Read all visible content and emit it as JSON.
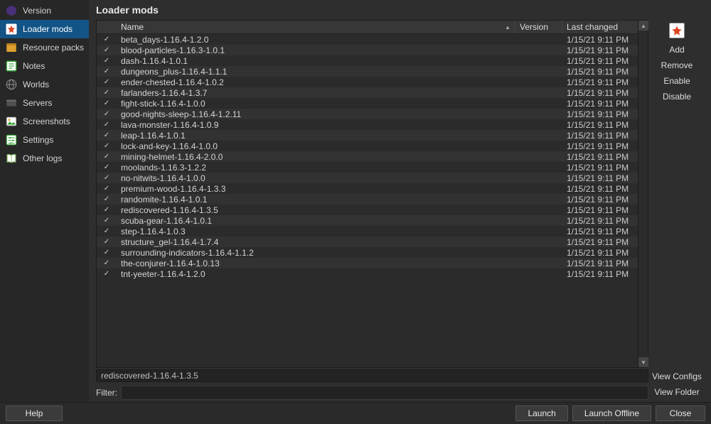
{
  "sidebar": {
    "items": [
      {
        "label": "Version",
        "icon": "cube",
        "color": "#6a3fa0"
      },
      {
        "label": "Loader mods",
        "icon": "star",
        "color": "#fff",
        "selected": true
      },
      {
        "label": "Resource packs",
        "icon": "box",
        "color": "#e0a030"
      },
      {
        "label": "Notes",
        "icon": "note",
        "color": "#3ba63b"
      },
      {
        "label": "Worlds",
        "icon": "globe",
        "color": "#777"
      },
      {
        "label": "Servers",
        "icon": "server",
        "color": "#555"
      },
      {
        "label": "Screenshots",
        "icon": "image",
        "color": "#c83"
      },
      {
        "label": "Settings",
        "icon": "sliders",
        "color": "#3ba63b"
      },
      {
        "label": "Other logs",
        "icon": "book",
        "color": "#7a5"
      }
    ]
  },
  "header": {
    "title": "Loader mods"
  },
  "table": {
    "columns": {
      "name": "Name",
      "version": "Version",
      "last": "Last changed"
    },
    "rows": [
      {
        "name": "beta_days-1.16.4-1.2.0",
        "last": "1/15/21 9:11 PM"
      },
      {
        "name": "blood-particles-1.16.3-1.0.1",
        "last": "1/15/21 9:11 PM"
      },
      {
        "name": "dash-1.16.4-1.0.1",
        "last": "1/15/21 9:11 PM"
      },
      {
        "name": "dungeons_plus-1.16.4-1.1.1",
        "last": "1/15/21 9:11 PM"
      },
      {
        "name": "ender-chested-1.16.4-1.0.2",
        "last": "1/15/21 9:11 PM"
      },
      {
        "name": "farlanders-1.16.4-1.3.7",
        "last": "1/15/21 9:11 PM"
      },
      {
        "name": "fight-stick-1.16.4-1.0.0",
        "last": "1/15/21 9:11 PM"
      },
      {
        "name": "good-nights-sleep-1.16.4-1.2.11",
        "last": "1/15/21 9:11 PM"
      },
      {
        "name": "lava-monster-1.16.4-1.0.9",
        "last": "1/15/21 9:11 PM"
      },
      {
        "name": "leap-1.16.4-1.0.1",
        "last": "1/15/21 9:11 PM"
      },
      {
        "name": "lock-and-key-1.16.4-1.0.0",
        "last": "1/15/21 9:11 PM"
      },
      {
        "name": "mining-helmet-1.16.4-2.0.0",
        "last": "1/15/21 9:11 PM"
      },
      {
        "name": "moolands-1.16.3-1.2.2",
        "last": "1/15/21 9:11 PM"
      },
      {
        "name": "no-nitwits-1.16.4-1.0.0",
        "last": "1/15/21 9:11 PM"
      },
      {
        "name": "premium-wood-1.16.4-1.3.3",
        "last": "1/15/21 9:11 PM"
      },
      {
        "name": "randomite-1.16.4-1.0.1",
        "last": "1/15/21 9:11 PM"
      },
      {
        "name": "rediscovered-1.16.4-1.3.5",
        "last": "1/15/21 9:11 PM"
      },
      {
        "name": "scuba-gear-1.16.4-1.0.1",
        "last": "1/15/21 9:11 PM"
      },
      {
        "name": "step-1.16.4-1.0.3",
        "last": "1/15/21 9:11 PM"
      },
      {
        "name": "structure_gel-1.16.4-1.7.4",
        "last": "1/15/21 9:11 PM"
      },
      {
        "name": "surrounding-indicators-1.16.4-1.1.2",
        "last": "1/15/21 9:11 PM"
      },
      {
        "name": "the-conjurer-1.16.4-1.0.13",
        "last": "1/15/21 9:11 PM"
      },
      {
        "name": "tnt-yeeter-1.16.4-1.2.0",
        "last": "1/15/21 9:11 PM"
      }
    ]
  },
  "status": "rediscovered-1.16.4-1.3.5",
  "filter": {
    "label": "Filter:",
    "value": ""
  },
  "actions": {
    "add": "Add",
    "remove": "Remove",
    "enable": "Enable",
    "disable": "Disable",
    "viewConfigs": "View Configs",
    "viewFolder": "View Folder"
  },
  "footer": {
    "help": "Help",
    "launch": "Launch",
    "launchOffline": "Launch Offline",
    "close": "Close"
  }
}
